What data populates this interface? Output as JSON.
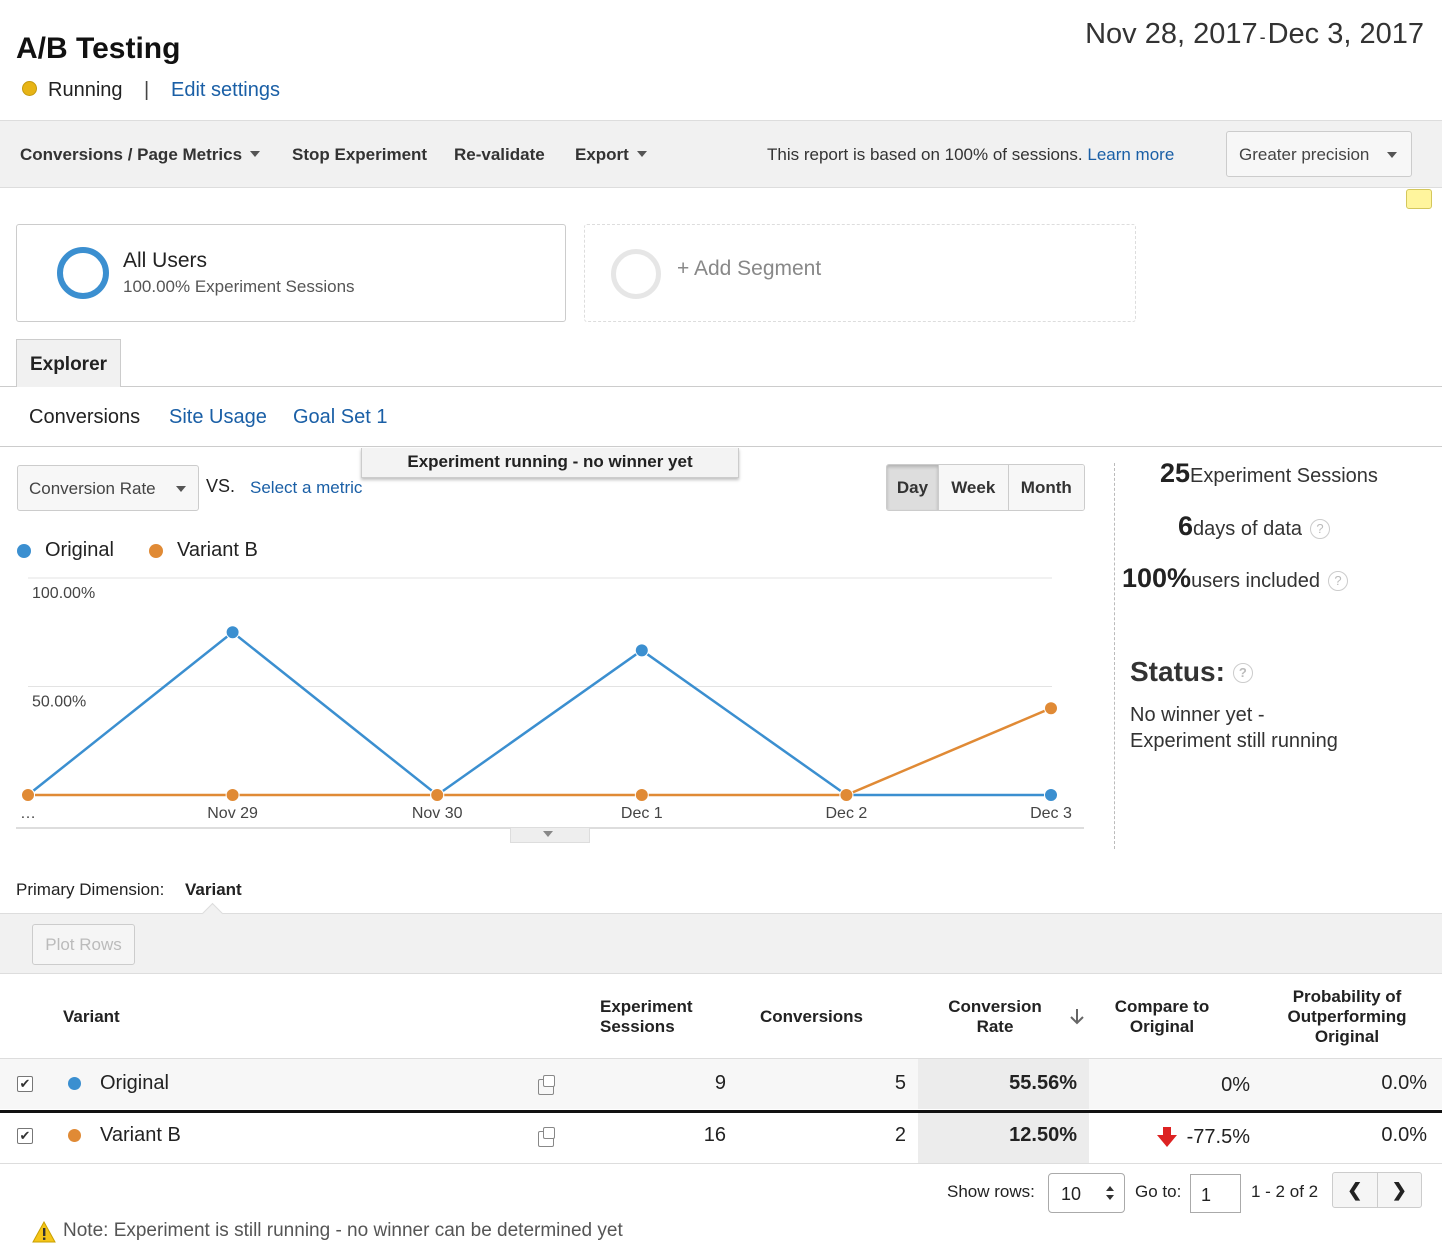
{
  "header": {
    "title": "A/B Testing",
    "status": "Running",
    "separator": "|",
    "edit_settings": "Edit settings",
    "date_start": "Nov 28, 2017",
    "date_dash": "-",
    "date_end": "Dec 3, 2017"
  },
  "toolbar": {
    "report_menu": "Conversions / Page Metrics",
    "stop": "Stop Experiment",
    "revalidate": "Re-validate",
    "export": "Export",
    "note": "This report is based on 100% of sessions.",
    "learn_more": "Learn more",
    "precision": "Greater precision"
  },
  "segments": {
    "active_name": "All Users",
    "active_sub": "100.00% Experiment Sessions",
    "add_label": "+ Add Segment"
  },
  "tabs": {
    "explorer": "Explorer",
    "subtabs": [
      "Conversions",
      "Site Usage",
      "Goal Set 1"
    ]
  },
  "chart_controls": {
    "metric": "Conversion Rate",
    "vs": "VS.",
    "select_metric": "Select a metric",
    "banner": "Experiment running - no winner yet",
    "periods": [
      "Day",
      "Week",
      "Month"
    ],
    "active_period": "Day"
  },
  "colors": {
    "original": "#3b8fd0",
    "variant_b": "#e08a35"
  },
  "chart_data": {
    "type": "line",
    "x": [
      "…",
      "Nov 29",
      "Nov 30",
      "Dec 1",
      "Dec 2",
      "Dec 3"
    ],
    "series": [
      {
        "name": "Original",
        "values": [
          0,
          75,
          0,
          66.67,
          0,
          0
        ]
      },
      {
        "name": "Variant B",
        "values": [
          0,
          0,
          0,
          0,
          0,
          40
        ]
      }
    ],
    "y_ticks": [
      "100.00%",
      "50.00%"
    ],
    "ylim": [
      0,
      100
    ],
    "legend": "top-left",
    "grid": true
  },
  "side_stats": {
    "sessions_num": "25",
    "sessions_label": "Experiment Sessions",
    "days_num": "6",
    "days_label": "days of data",
    "users_num": "100%",
    "users_label": "users included",
    "help": "?",
    "status_title": "Status:",
    "status_line1": "No winner yet -",
    "status_line2": "Experiment still running"
  },
  "table": {
    "dimension_label": "Primary Dimension:",
    "dimension_value": "Variant",
    "plot_rows": "Plot Rows",
    "headers": {
      "variant": "Variant",
      "sessions_1": "Experiment",
      "sessions_2": "Sessions",
      "conversions": "Conversions",
      "rate_1": "Conversion",
      "rate_2": "Rate",
      "compare_1": "Compare to",
      "compare_2": "Original",
      "prob_1": "Probability of",
      "prob_2": "Outperforming",
      "prob_3": "Original"
    },
    "rows": [
      {
        "name": "Original",
        "sessions": "9",
        "conversions": "5",
        "rate": "55.56%",
        "compare": "0%",
        "probability": "0.0%"
      },
      {
        "name": "Variant B",
        "sessions": "16",
        "conversions": "2",
        "rate": "12.50%",
        "compare": "-77.5%",
        "probability": "0.0%"
      }
    ],
    "show_rows_label": "Show rows:",
    "show_rows_value": "10",
    "goto_label": "Go to:",
    "goto_value": "1",
    "range": "1 - 2 of 2",
    "note": "Note: Experiment is still running - no winner can be determined yet"
  }
}
